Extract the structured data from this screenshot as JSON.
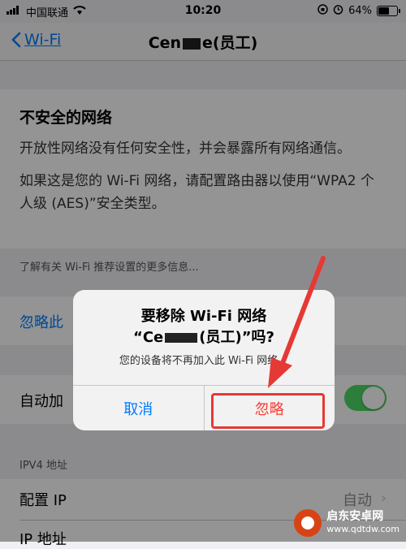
{
  "status_bar": {
    "carrier": "中国联通",
    "time": "10:20",
    "battery": "64%",
    "battery_level": 0.64
  },
  "nav": {
    "back_label": "Wi-Fi",
    "title_prefix": "Cen",
    "title_suffix": "e(员工)"
  },
  "warning": {
    "title": "不安全的网络",
    "para1": "开放性网络没有任何安全性，并会暴露所有网络通信。",
    "para2": "如果这是您的 Wi-Fi 网络，请配置路由器以使用“WPA2 个人级 (AES)”安全类型。"
  },
  "footnote": "了解有关 Wi-Fi 推荐设置的更多信息...",
  "ignore_row": "忽略此",
  "auto_join": {
    "label": "自动加",
    "enabled": true
  },
  "ipv4": {
    "header": "IPV4 地址",
    "config_label": "配置 IP",
    "config_value": "自动",
    "ip_label": "IP 地址"
  },
  "alert": {
    "title_line1": "要移除 Wi-Fi 网络",
    "title_line2_prefix": "“Ce",
    "title_line2_suffix": "(员工)”吗?",
    "message": "您的设备将不再加入此 Wi-Fi 网络。",
    "cancel": "取消",
    "ignore": "忽略"
  },
  "watermark": {
    "name": "启东安卓网",
    "url": "www.qdtdw.com"
  },
  "colors": {
    "accent": "#007aff",
    "destructive": "#ff3b30",
    "toggle_on": "#4cd964",
    "annotation": "#e53935"
  }
}
